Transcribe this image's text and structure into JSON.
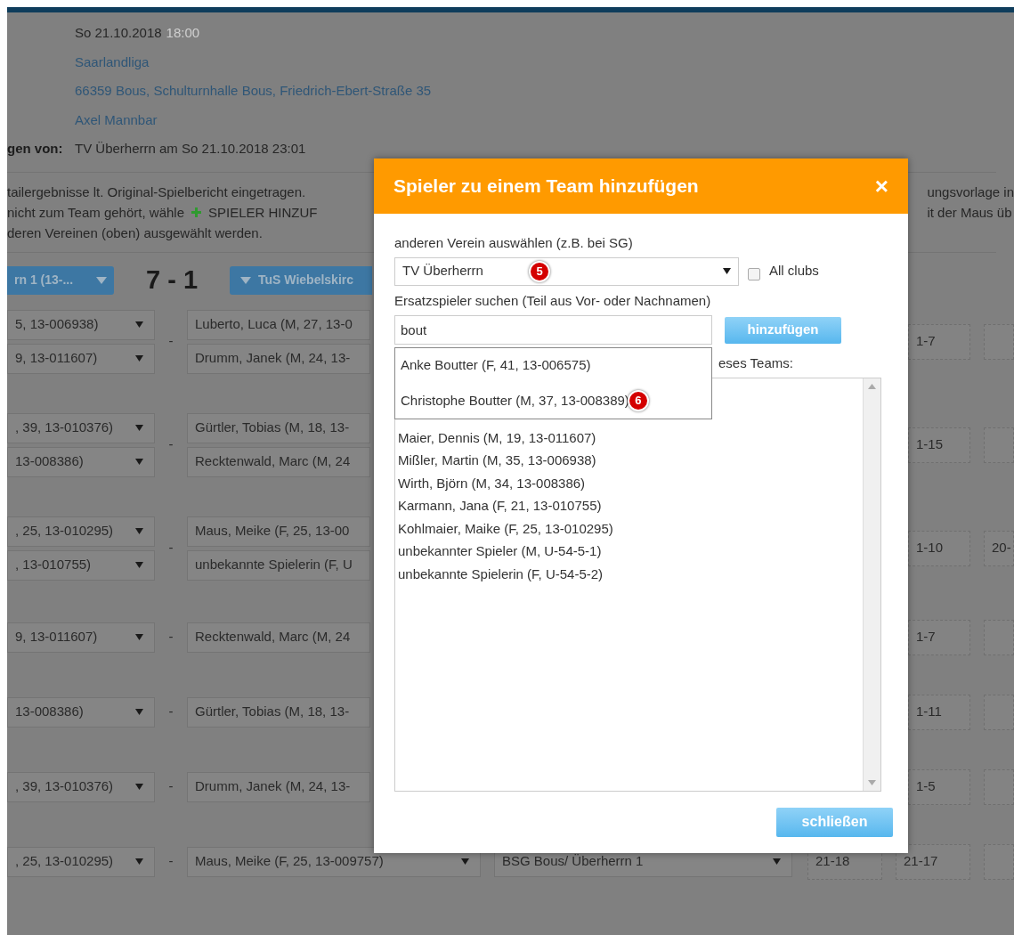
{
  "header": {
    "date": "So 21.10.2018",
    "time": "18:00",
    "league": "Saarlandliga",
    "venue": "66359 Bous, Schulturnhalle Bous, Friedrich-Ebert-Straße 35",
    "referee": "Axel Mannbar",
    "entered_label": "gen von:",
    "entered_value": "TV Überherrn am So 21.10.2018 23:01"
  },
  "notice": {
    "left_lines": [
      {
        "text": "tailergebnisse lt. Original-Spielbericht eingetragen."
      },
      {
        "text": "nicht zum Team gehört, wähle",
        "plus_text": "SPIELER HINZUF"
      },
      {
        "text": "deren Vereinen (oben) ausgewählt werden."
      }
    ],
    "right_lines": [
      "ungsvorlage in",
      "it der Maus üb"
    ]
  },
  "scoreline": {
    "home_team": "rn 1 (13-...",
    "score": "7 - 1",
    "away_team": "TuS Wiebelskirc"
  },
  "matches": [
    {
      "kind": "covered",
      "dash": "-",
      "home": [
        "5, 13-006938)",
        "9, 13-011607)"
      ],
      "away": [
        "Luberto, Luca (M, 27, 13-0",
        "Drumm, Janek (M, 24, 13-"
      ],
      "scores": [
        "1-7"
      ]
    },
    {
      "kind": "covered",
      "dash": "-",
      "home": [
        ", 39, 13-010376)",
        "13-008386)"
      ],
      "away": [
        "Gürtler, Tobias (M, 18, 13-",
        "Recktenwald, Marc (M, 24"
      ],
      "scores": [
        "1-15"
      ]
    },
    {
      "kind": "covered",
      "dash": "-",
      "home": [
        ", 25, 13-010295)",
        ", 13-010755)"
      ],
      "away": [
        "Maus, Meike (F, 25, 13-00",
        "unbekannte Spielerin (F, U"
      ],
      "scores": [
        "1-10",
        "20-"
      ]
    },
    {
      "kind": "covered",
      "dash": "-",
      "home": [
        "9, 13-011607)"
      ],
      "away": [
        "Recktenwald, Marc (M, 24"
      ],
      "scores": [
        "1-7"
      ]
    },
    {
      "kind": "covered",
      "dash": "-",
      "home": [
        "13-008386)"
      ],
      "away": [
        "Gürtler, Tobias (M, 18, 13-"
      ],
      "scores": [
        "1-11"
      ]
    },
    {
      "kind": "covered",
      "dash": "-",
      "home": [
        ", 39, 13-010376)"
      ],
      "away": [
        "Drumm, Janek (M, 24, 13-"
      ],
      "scores": [
        "1-5"
      ]
    },
    {
      "kind": "full",
      "dash": "-",
      "home": [
        ", 25, 13-010295)"
      ],
      "away": [
        "Maus, Meike (F, 25, 13-009757)"
      ],
      "team": "BSG Bous/ Überherrn 1",
      "scores": [
        "21-18",
        "21-17"
      ]
    }
  ],
  "modal": {
    "title": "Spieler zu einem Team hinzufügen",
    "close": "×",
    "club_label": "anderen Verein auswählen (z.B. bei SG)",
    "club_value": "TV Überherrn",
    "club_badge": "5",
    "all_clubs": {
      "label": "All clubs",
      "checked": false
    },
    "search_label": "Ersatzspieler suchen (Teil aus Vor- oder Nachnamen)",
    "search_value": "bout",
    "add_button": "hinzufügen",
    "suggestions": [
      {
        "text": "Anke Boutter (F, 41, 13-006575)"
      },
      {
        "text": "Christophe Boutter (M, 37, 13-008389)",
        "badge": "6"
      }
    ],
    "team_label": "eses Teams:",
    "team_players": [
      "Maier, Dennis (M, 19, 13-011607)",
      "Mißler, Martin (M, 35, 13-006938)",
      "Wirth, Björn (M, 34, 13-008386)",
      "Karmann, Jana (F, 21, 13-010755)",
      "Kohlmaier, Maike (F, 25, 13-010295)",
      "unbekannter Spieler (M, U-54-5-1)",
      "unbekannte Spielerin (F, U-54-5-2)"
    ],
    "close_button": "schließen"
  }
}
